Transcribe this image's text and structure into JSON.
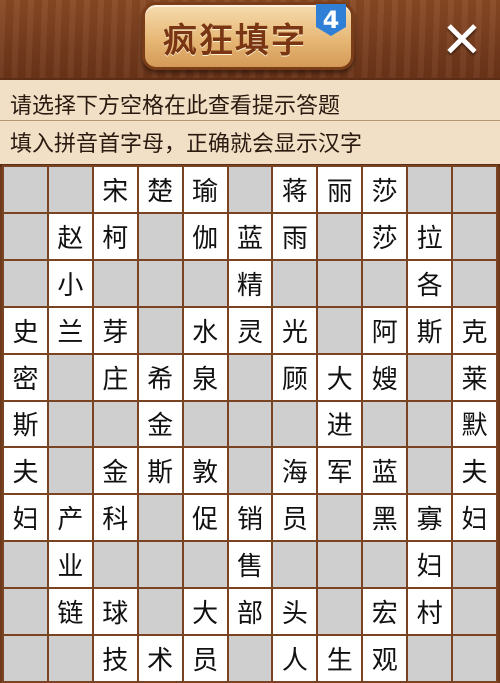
{
  "header": {
    "title": "疯狂填字",
    "level": "4",
    "close_icon": "close-icon",
    "close_label": "✕"
  },
  "hints": {
    "line1": "请选择下方空格在此查看提示答题",
    "line2": "填入拼音首字母，正确就会显示汉字"
  },
  "grid": {
    "rows": [
      [
        "",
        "",
        "宋",
        "楚",
        "瑜",
        "",
        "蒋",
        "丽",
        "莎",
        "",
        ""
      ],
      [
        "",
        "赵",
        "柯",
        "",
        "伽",
        "蓝",
        "雨",
        "",
        "莎",
        "拉",
        ""
      ],
      [
        "",
        "小",
        "",
        "",
        "",
        "精",
        "",
        "",
        "",
        "各",
        ""
      ],
      [
        "史",
        "兰",
        "芽",
        "",
        "水",
        "灵",
        "光",
        "",
        "阿",
        "斯",
        "克"
      ],
      [
        "密",
        "",
        "庄",
        "希",
        "泉",
        "",
        "顾",
        "大",
        "嫂",
        "",
        "莱"
      ],
      [
        "斯",
        "",
        "",
        "金",
        "",
        "",
        "",
        "进",
        "",
        "",
        "默"
      ],
      [
        "夫",
        "",
        "金",
        "斯",
        "敦",
        "",
        "海",
        "军",
        "蓝",
        "",
        "夫"
      ],
      [
        "妇",
        "产",
        "科",
        "",
        "促",
        "销",
        "员",
        "",
        "黑",
        "寡",
        "妇"
      ],
      [
        "",
        "业",
        "",
        "",
        "",
        "售",
        "",
        "",
        "",
        "妇",
        ""
      ],
      [
        "",
        "链",
        "球",
        "",
        "大",
        "部",
        "头",
        "",
        "宏",
        "村",
        ""
      ],
      [
        "",
        "",
        "技",
        "术",
        "员",
        "",
        "人",
        "生",
        "观",
        "",
        ""
      ]
    ],
    "filled_mask": [
      [
        0,
        0,
        1,
        1,
        1,
        0,
        1,
        1,
        1,
        0,
        0
      ],
      [
        0,
        1,
        1,
        0,
        1,
        1,
        1,
        0,
        1,
        1,
        0
      ],
      [
        0,
        1,
        0,
        0,
        0,
        1,
        0,
        0,
        0,
        1,
        0
      ],
      [
        1,
        1,
        1,
        0,
        1,
        1,
        1,
        0,
        1,
        1,
        1
      ],
      [
        1,
        0,
        1,
        1,
        1,
        0,
        1,
        1,
        1,
        0,
        1
      ],
      [
        1,
        0,
        0,
        1,
        0,
        0,
        0,
        1,
        0,
        0,
        1
      ],
      [
        1,
        0,
        1,
        1,
        1,
        0,
        1,
        1,
        1,
        0,
        1
      ],
      [
        1,
        1,
        1,
        0,
        1,
        1,
        1,
        0,
        1,
        1,
        1
      ],
      [
        0,
        1,
        0,
        0,
        0,
        1,
        0,
        0,
        0,
        1,
        0
      ],
      [
        0,
        1,
        1,
        0,
        1,
        1,
        1,
        0,
        1,
        1,
        0
      ],
      [
        0,
        0,
        1,
        1,
        1,
        0,
        1,
        1,
        1,
        0,
        0
      ]
    ]
  }
}
